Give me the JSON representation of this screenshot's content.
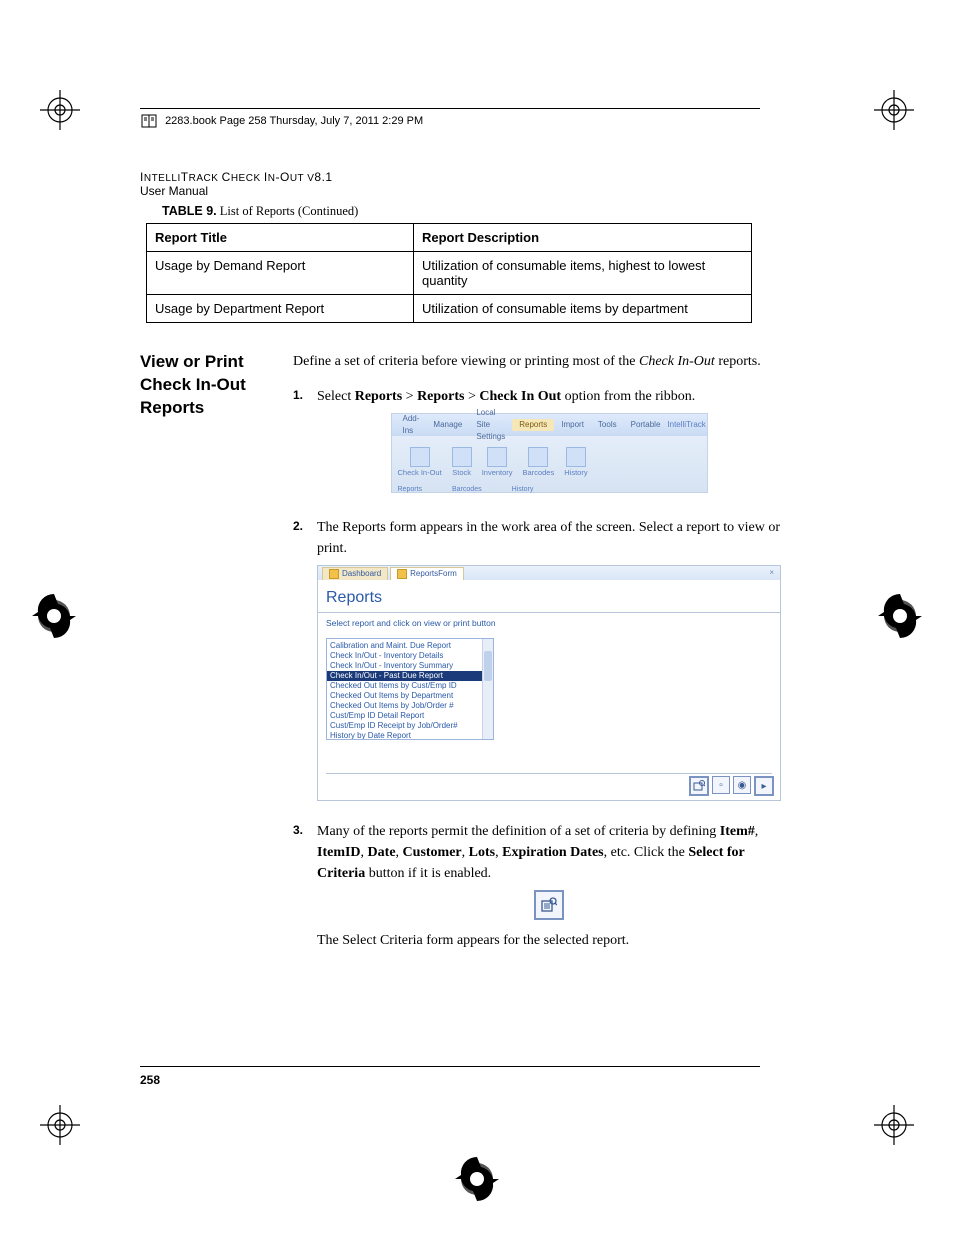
{
  "header": {
    "book_line": "2283.book  Page 258  Thursday, July 7, 2011  2:29 PM",
    "product": "IntelliTrack Check In-Out v8.1",
    "product_caps_prefix": "I",
    "product_caps_rest": "NTELLI",
    "product_caps_prefix2": "T",
    "product_caps_rest2": "RACK ",
    "product_caps_prefix3": "C",
    "product_caps_rest3": "HECK ",
    "product_caps_prefix4": "I",
    "product_caps_rest4": "N",
    "product_dash": "-O",
    "product_caps_rest5": "UT V",
    "product_version": "8.1",
    "manual": "User Manual"
  },
  "table": {
    "caption_label": "TABLE 9.",
    "caption_title": " List of Reports (Continued)",
    "col1": "Report Title",
    "col2": "Report Description",
    "rows": [
      {
        "title": "Usage by Demand Report",
        "desc": "Utilization of consumable items, highest to lowest quantity"
      },
      {
        "title": "Usage by Department Report",
        "desc": "Utilization of consumable items by department"
      }
    ]
  },
  "side_heading": "View or Print Check In-Out Reports",
  "intro_a": "Define a set of criteria before viewing or printing most of the ",
  "intro_em": "Check In-Out",
  "intro_b": " reports.",
  "step1": {
    "pre": "Select ",
    "b1": "Reports",
    "sep1": " > ",
    "b2": "Reports",
    "sep2": " > ",
    "b3": "Check In Out",
    "post": " option from the ribbon."
  },
  "ribbon": {
    "tabs": [
      "Add-Ins",
      "Manage",
      "Local Site Settings",
      "Reports",
      "Import",
      "Tools",
      "Portable"
    ],
    "brand": "IntelliTrack",
    "groups_items": [
      "Check In-Out",
      "Stock",
      "Inventory",
      "Barcodes",
      "History"
    ],
    "groups_labels": [
      "Reports",
      "Barcodes",
      "History"
    ]
  },
  "step2": "The Reports form appears in the work area of the screen. Select a report to view or print.",
  "form": {
    "tab1": "Dashboard",
    "tab2": "ReportsForm",
    "title": "Reports",
    "instruction": "Select report and click on view or print button",
    "list": [
      "Calibration and Maint. Due Report",
      "Check In/Out - Inventory Details",
      "Check In/Out - Inventory Summary",
      "Check In/Out - Past Due Report",
      "Checked Out Items by Cust/Emp ID",
      "Checked Out Items by Department",
      "Checked Out Items by Job/Order #",
      "Cust/Emp ID Detail Report",
      "Cust/Emp ID Receipt by Job/Order#",
      "History by Date Report"
    ],
    "selected_index": 3
  },
  "step3": {
    "a": "Many of the reports permit the definition of a set of criteria by defining ",
    "b1": "Item#",
    "c1": ", ",
    "b2": "ItemID",
    "c2": ", ",
    "b3": "Date",
    "c3": ", ",
    "b4": "Customer",
    "c4": ", ",
    "b5": "Lots",
    "c5": ", ",
    "b6": "Expiration Dates",
    "c6": ", etc. Click the ",
    "b7": "Select for Criteria",
    "c7": " button if it is enabled."
  },
  "step3_after": "The Select Criteria form appears for the selected report.",
  "page_number": "258"
}
